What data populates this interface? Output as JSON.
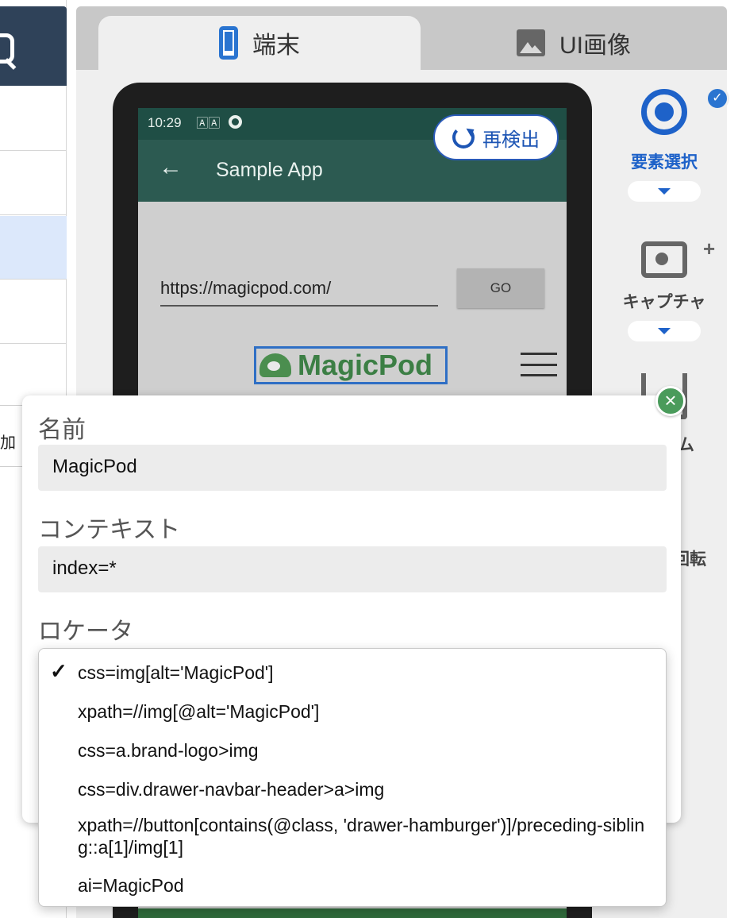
{
  "tabs": {
    "device": "端末",
    "ui_image": "UI画像"
  },
  "device": {
    "status_time": "10:29",
    "status_sim": "🄰🄰",
    "app_title": "Sample App",
    "back_glyph": "←",
    "url_value": "https://magicpod.com/",
    "go_label": "GO",
    "logo_text": "MagicPod"
  },
  "redetect_label": "再検出",
  "tools": {
    "element_select": "要素選択",
    "capture": "キャプチャ",
    "home_partial": "ム",
    "rotate_partial": "回転"
  },
  "left_panel": {
    "add_partial": "加"
  },
  "dialog": {
    "name_label": "名前",
    "name_value": "MagicPod",
    "context_label": "コンテキスト",
    "context_value": "index=*",
    "locator_label": "ロケータ",
    "close_glyph": "×",
    "faded_add": "追加"
  },
  "locator_menu": {
    "selected_index": 0,
    "check_glyph": "✓",
    "items": [
      "css=img[alt='MagicPod']",
      "xpath=//img[@alt='MagicPod']",
      "css=a.brand-logo>img",
      "css=div.drawer-navbar-header>a>img",
      "xpath=//button[contains(@class, 'drawer-hamburger')]/preceding-sibling::a[1]/img[1]",
      "ai=MagicPod"
    ]
  },
  "colors": {
    "accent": "#1e62c9",
    "appbar": "#2c5a51",
    "statusbar": "#1f4e45",
    "close": "#4a9b5b",
    "left_header": "#2f4259"
  }
}
